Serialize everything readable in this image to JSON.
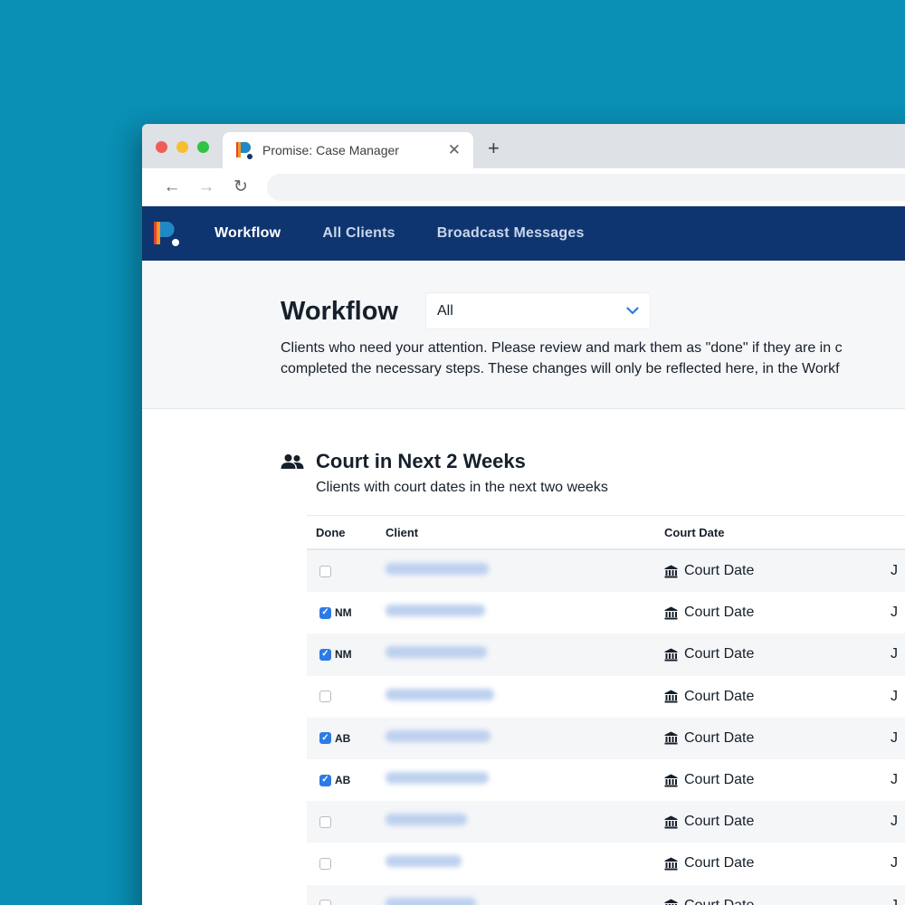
{
  "browser": {
    "tab_title": "Promise: Case Manager",
    "tab_close": "✕",
    "new_tab": "+",
    "back": "←",
    "forward": "→",
    "reload": "↻"
  },
  "nav": {
    "items": [
      {
        "label": "Workflow",
        "active": true
      },
      {
        "label": "All Clients",
        "active": false
      },
      {
        "label": "Broadcast Messages",
        "active": false
      }
    ]
  },
  "workflow": {
    "title": "Workflow",
    "filter_value": "All",
    "description_line1": "Clients who need your attention. Please review and mark them as \"done\" if they are in c",
    "description_line2": "completed the necessary steps. These changes will only be reflected here, in the Workf"
  },
  "section": {
    "title": "Court in Next 2 Weeks",
    "subtitle": "Clients with court dates in the next two weeks",
    "columns": {
      "done": "Done",
      "client": "Client",
      "court_date": "Court Date"
    },
    "rows": [
      {
        "done": false,
        "initials": "",
        "court": "Court Date",
        "next": "J"
      },
      {
        "done": true,
        "initials": "NM",
        "court": "Court Date",
        "next": "J"
      },
      {
        "done": true,
        "initials": "NM",
        "court": "Court Date",
        "next": "J"
      },
      {
        "done": false,
        "initials": "",
        "court": "Court Date",
        "next": "J"
      },
      {
        "done": true,
        "initials": "AB",
        "court": "Court Date",
        "next": "J"
      },
      {
        "done": true,
        "initials": "AB",
        "court": "Court Date",
        "next": "J"
      },
      {
        "done": false,
        "initials": "",
        "court": "Court Date",
        "next": "J"
      },
      {
        "done": false,
        "initials": "",
        "court": "Court Date",
        "next": "J"
      },
      {
        "done": false,
        "initials": "",
        "court": "Court Date",
        "next": "J"
      }
    ]
  },
  "colors": {
    "page_background": "#0a8fb5",
    "nav_background": "#0e3570",
    "checkbox_checked": "#2c7be5"
  }
}
